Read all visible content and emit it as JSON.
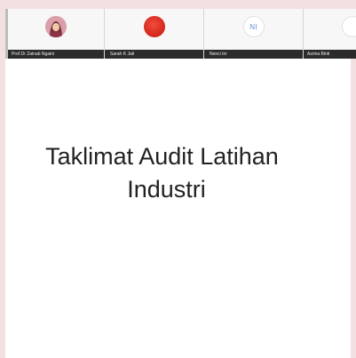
{
  "participants": [
    {
      "name": "Prof Dr Zainab Ngaini",
      "avatar": "photo"
    },
    {
      "name": "Sarah K Jali",
      "avatar": "red-circle"
    },
    {
      "name": "Nenci Ini",
      "avatar": "initials",
      "initials": "NI"
    },
    {
      "name": "Azrina Binti",
      "avatar": "partial"
    }
  ],
  "slide": {
    "title_line1": "Taklimat Audit Latihan",
    "title_line2": "Industri"
  },
  "colors": {
    "page_bg": "#f3e1e1",
    "strip_bg": "#f7f7f7",
    "name_bar": "#2b2b2b",
    "slide_bg": "#ffffff",
    "avatar_red": "#d72b1f",
    "initials_text": "#5b8fd1"
  }
}
